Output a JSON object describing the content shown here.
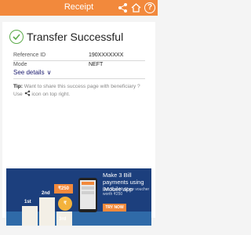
{
  "header": {
    "title": "Receipt",
    "help_label": "?"
  },
  "status": {
    "title": "Transfer Successful"
  },
  "details": [
    {
      "label": "Reference ID",
      "value": "190XXXXXXX"
    },
    {
      "label": "Mode",
      "value": "NEFT"
    }
  ],
  "see_details_label": "See details",
  "tip": {
    "prefix": "Tip:",
    "text_before_icon": " Want to share this success page with beneficiary ? Use ",
    "text_after_icon": " icon on top right."
  },
  "banner": {
    "headline": "Make 3 Bill payments using iMobile app",
    "subtext": "Get BookMyShow voucher worth ₹250",
    "cta_label": "TRY NOW",
    "price_tag": "₹250",
    "coin_label": "₹",
    "podium": [
      "1st",
      "2nd",
      "3rd"
    ]
  },
  "carousel": {
    "total": 2,
    "active_index": 0
  },
  "colors": {
    "accent": "#f2893c",
    "success": "#5cab4a",
    "banner_bg": "#1c3f7d"
  }
}
